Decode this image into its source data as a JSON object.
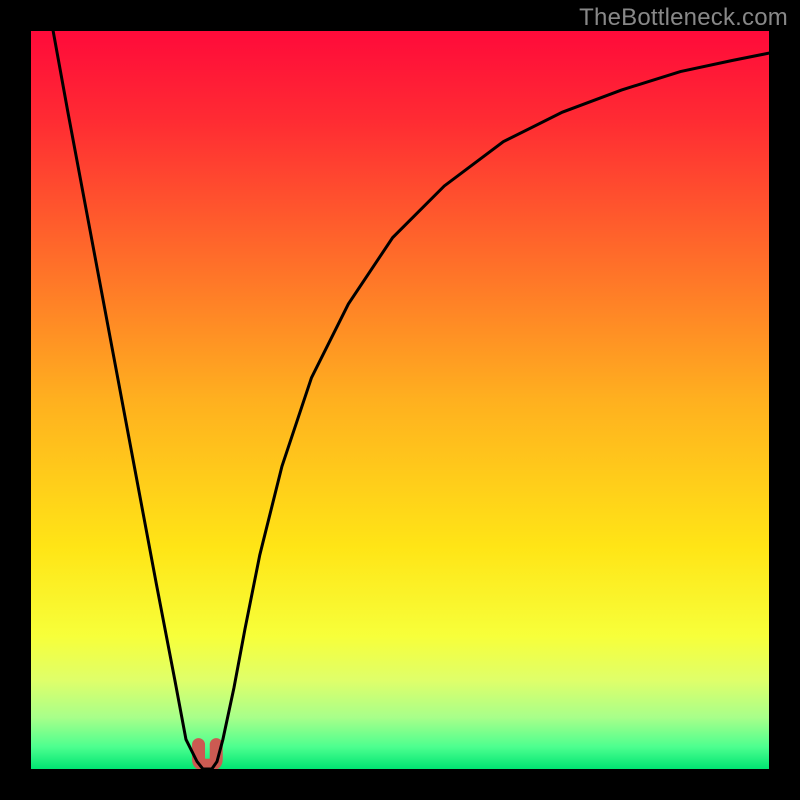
{
  "attribution": "TheBottleneck.com",
  "colors": {
    "gradient_stops": [
      {
        "offset": 0.0,
        "color": "#ff0a3a"
      },
      {
        "offset": 0.12,
        "color": "#ff2b33"
      },
      {
        "offset": 0.3,
        "color": "#ff6a2a"
      },
      {
        "offset": 0.5,
        "color": "#ffb01f"
      },
      {
        "offset": 0.7,
        "color": "#ffe516"
      },
      {
        "offset": 0.82,
        "color": "#f7ff3a"
      },
      {
        "offset": 0.88,
        "color": "#dfff6a"
      },
      {
        "offset": 0.93,
        "color": "#a8ff8a"
      },
      {
        "offset": 0.97,
        "color": "#4dff8f"
      },
      {
        "offset": 1.0,
        "color": "#00e472"
      }
    ],
    "curve": "#000000",
    "marker": "#cc5a52",
    "frame": "#000000"
  },
  "chart_data": {
    "type": "line",
    "title": "",
    "xlabel": "",
    "ylabel": "",
    "xlim": [
      0,
      100
    ],
    "ylim": [
      0,
      100
    ],
    "grid": false,
    "legend": false,
    "series": [
      {
        "name": "bottleneck-curve",
        "x": [
          3,
          5,
          8,
          11,
          14,
          17,
          19.5,
          21,
          22.5,
          23.3,
          24.5,
          25.2,
          26,
          27.5,
          29,
          31,
          34,
          38,
          43,
          49,
          56,
          64,
          72,
          80,
          88,
          95,
          100
        ],
        "y": [
          100,
          89,
          73,
          57,
          41,
          25,
          12,
          4,
          1,
          0,
          0,
          1,
          4,
          11,
          19,
          29,
          41,
          53,
          63,
          72,
          79,
          85,
          89,
          92,
          94.5,
          96,
          97
        ]
      }
    ],
    "annotations": [
      {
        "name": "optimal-marker",
        "shape": "u",
        "x_center": 23.9,
        "x_width": 2.4,
        "y_top": 3.3,
        "y_bottom": 0.5
      }
    ]
  }
}
